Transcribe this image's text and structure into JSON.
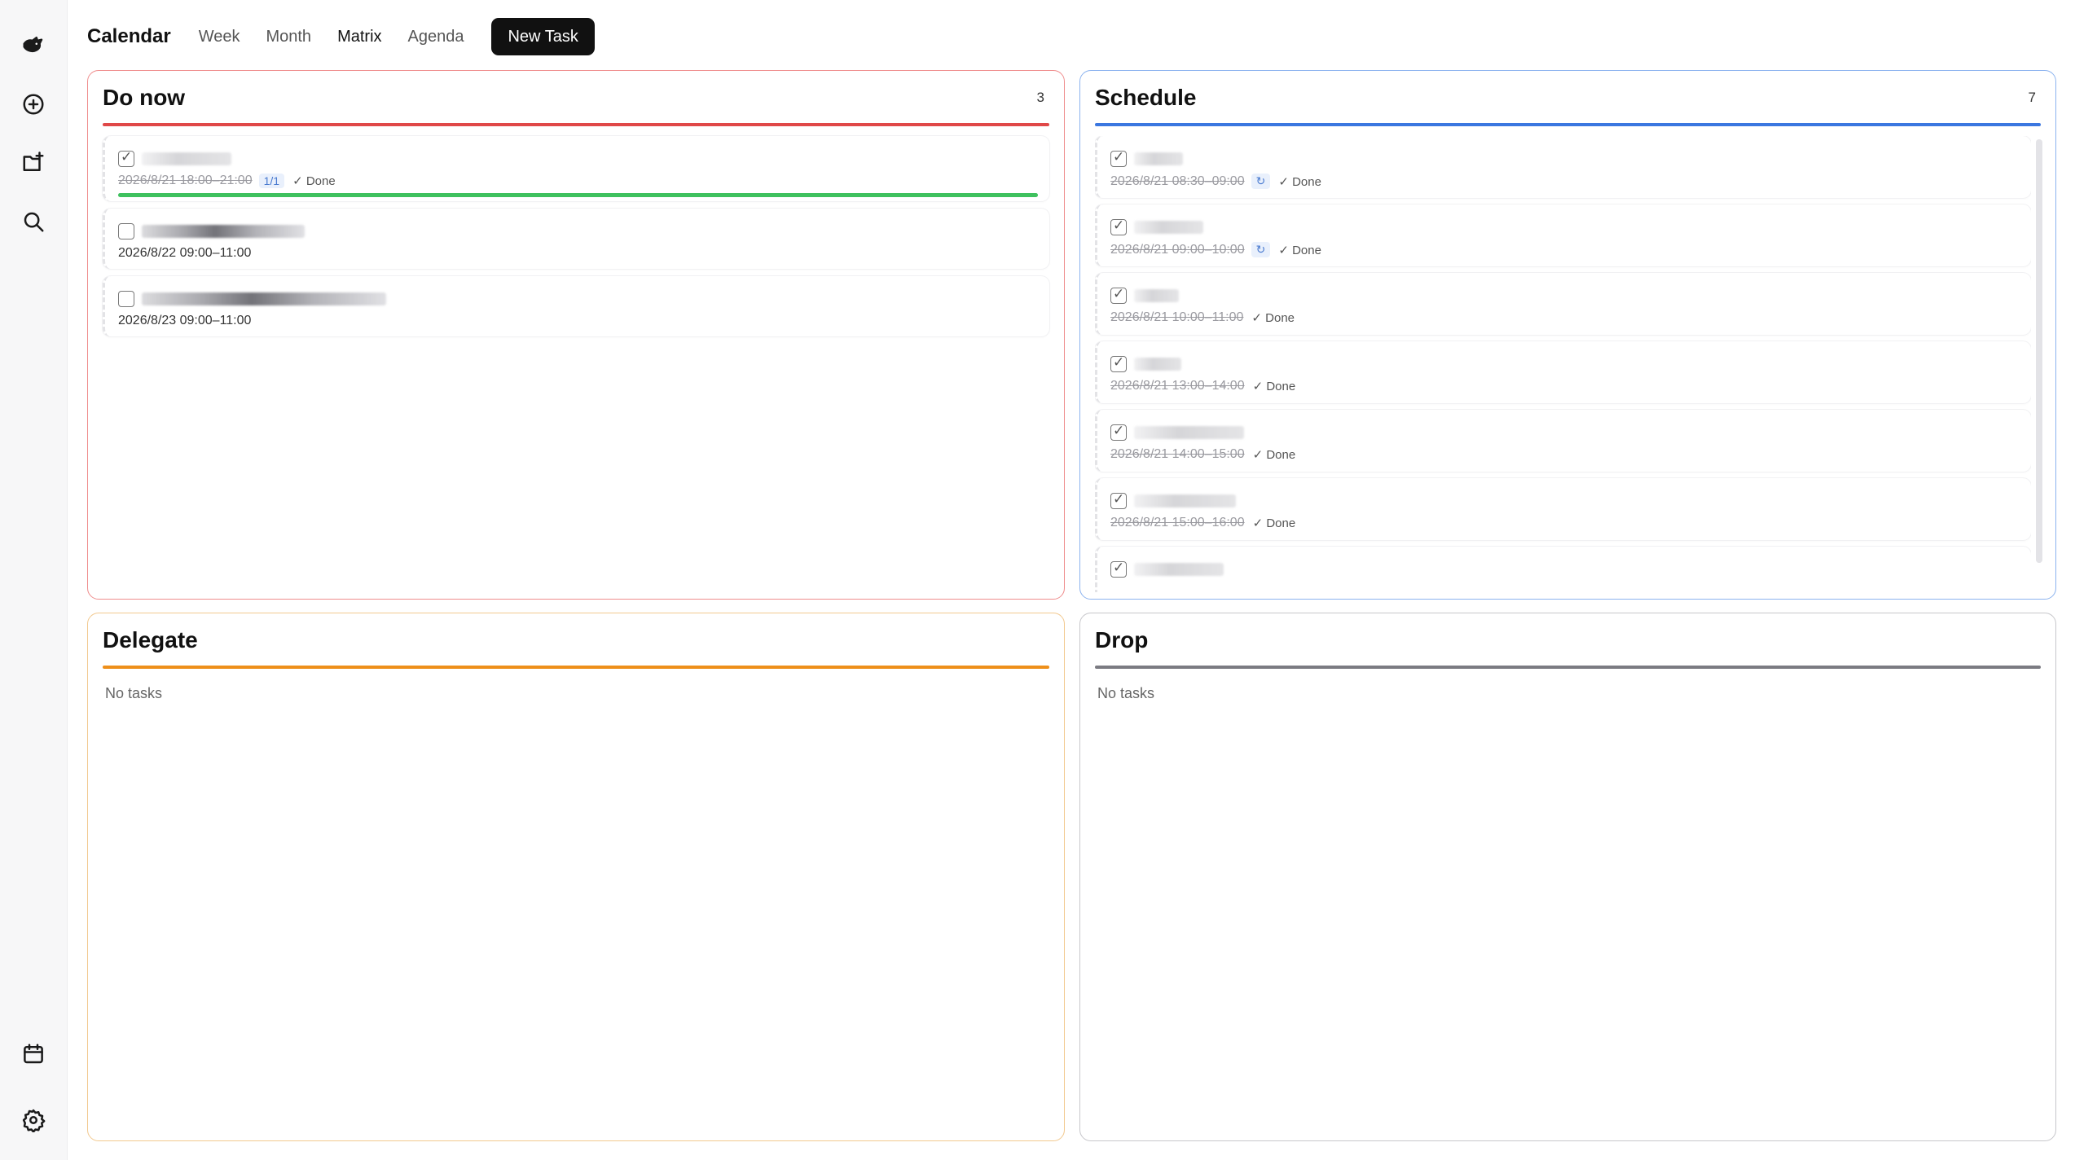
{
  "header": {
    "title": "Calendar",
    "tabs": [
      {
        "label": "Week"
      },
      {
        "label": "Month"
      },
      {
        "label": "Matrix"
      },
      {
        "label": "Agenda"
      }
    ],
    "active_tab": "Matrix",
    "new_task_label": "New Task"
  },
  "sidebar": {
    "top_icons": [
      "logo-icon",
      "add-circle-icon",
      "add-folder-icon",
      "search-icon"
    ],
    "bottom_icons": [
      "calendar-icon",
      "settings-icon"
    ]
  },
  "quadrants": {
    "do_now": {
      "title": "Do now",
      "count": "3",
      "color": "#e04848",
      "tasks": [
        {
          "date": "2026/8/21 18:00–21:00",
          "badge": "1/1",
          "done": "✓ Done",
          "checked": true,
          "progress": 1.0
        },
        {
          "date": "2026/8/22 09:00–11:00",
          "checked": false
        },
        {
          "date": "2026/8/23 09:00–11:00",
          "checked": false
        }
      ]
    },
    "schedule": {
      "title": "Schedule",
      "count": "7",
      "color": "#3b77e0",
      "tasks": [
        {
          "date": "2026/8/21 08:30–09:00",
          "badge": "↻",
          "done": "✓ Done",
          "checked": true
        },
        {
          "date": "2026/8/21 09:00–10:00",
          "badge": "↻",
          "done": "✓ Done",
          "checked": true
        },
        {
          "date": "2026/8/21 10:00–11:00",
          "done": "✓ Done",
          "checked": true
        },
        {
          "date": "2026/8/21 13:00–14:00",
          "done": "✓ Done",
          "checked": true
        },
        {
          "date": "2026/8/21 14:00–15:00",
          "done": "✓ Done",
          "checked": true
        },
        {
          "date": "2026/8/21 15:00–16:00",
          "done": "✓ Done",
          "checked": true
        },
        {
          "checked": true
        }
      ]
    },
    "delegate": {
      "title": "Delegate",
      "color": "#ee8f1a",
      "empty": "No tasks"
    },
    "drop": {
      "title": "Drop",
      "color": "#7b7b82",
      "empty": "No tasks"
    }
  }
}
